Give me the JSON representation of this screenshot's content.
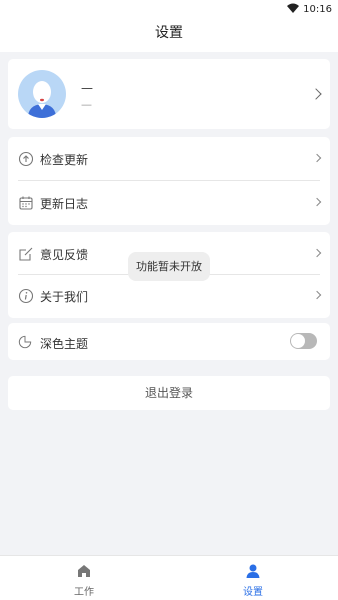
{
  "statusbar": {
    "time": "10:16"
  },
  "header": {
    "title": "设置"
  },
  "profile": {
    "name": "—",
    "sub": "—"
  },
  "menu_group1": [
    {
      "label": "检查更新",
      "icon": "upload-circle-icon"
    },
    {
      "label": "更新日志",
      "icon": "calendar-icon"
    }
  ],
  "menu_group2": [
    {
      "label": "意见反馈",
      "icon": "edit-icon"
    },
    {
      "label": "关于我们",
      "icon": "info-icon"
    }
  ],
  "theme": {
    "label": "深色主题",
    "icon": "moon-icon",
    "enabled": false
  },
  "logout": {
    "label": "退出登录"
  },
  "toast": {
    "text": "功能暂未开放"
  },
  "tabbar": {
    "items": [
      {
        "label": "工作",
        "icon": "home-icon",
        "active": false
      },
      {
        "label": "设置",
        "icon": "user-icon",
        "active": true
      }
    ]
  },
  "colors": {
    "accent": "#2a6fe6",
    "inactive": "#666666",
    "background": "#f2f3f6"
  }
}
